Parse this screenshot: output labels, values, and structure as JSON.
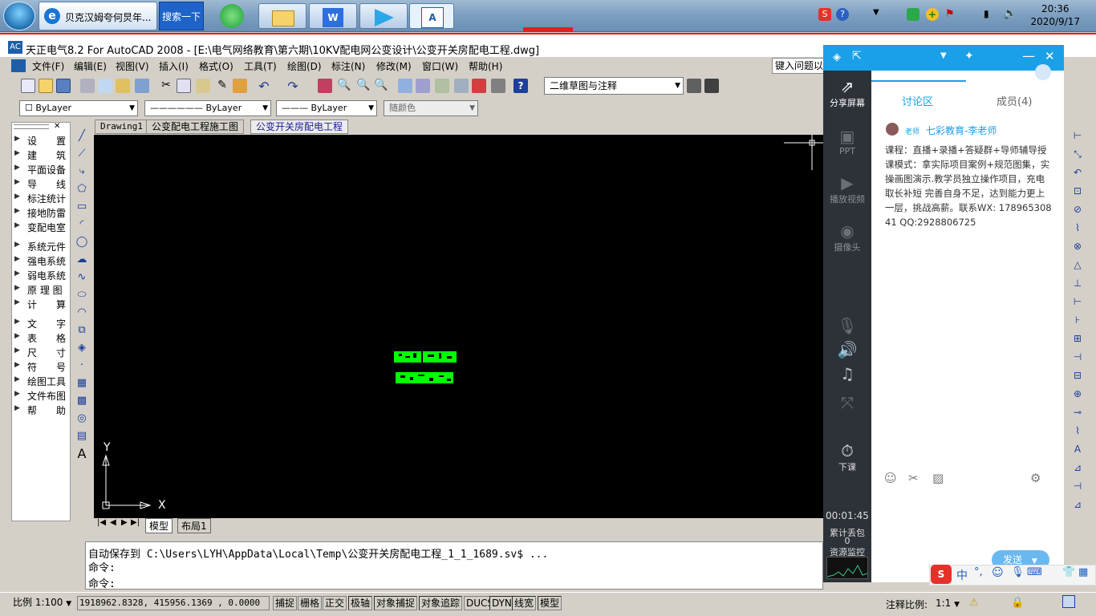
{
  "taskbar": {
    "ie_task_label": "贝克汉姆夸何炅年...",
    "search_button": "搜索一下",
    "clock_time": "20:36",
    "clock_date": "2020/9/17"
  },
  "window": {
    "title": "天正电气8.2 For AutoCAD 2008 - [E:\\电气网络教育\\第六期\\10KV配电网公变设计\\公变开关房配电工程.dwg]",
    "logo": "AC"
  },
  "menu": [
    "文件(F)",
    "编辑(E)",
    "视图(V)",
    "插入(I)",
    "格式(O)",
    "工具(T)",
    "绘图(D)",
    "标注(N)",
    "修改(M)",
    "窗口(W)",
    "帮助(H)"
  ],
  "help_search": "键入问题以",
  "toolbar": {
    "workspace": "二维草图与注释"
  },
  "layers": {
    "layer": "ByLayer",
    "linetype": "ByLayer",
    "lineweight": "ByLayer",
    "color": "随颜色"
  },
  "tianzheng_menu": [
    "设　　置",
    "建　　筑",
    "平面设备",
    "导　　线",
    "标注统计",
    "接地防雷",
    "变配电室",
    "系统元件",
    "强电系统",
    "弱电系统",
    "原 理 图",
    "计　　算",
    "文　　字",
    "表　　格",
    "尺　　寸",
    "符　　号",
    "绘图工具",
    "文件布图",
    "帮　　助"
  ],
  "doc_tabs": [
    "Drawing1",
    "公变配电工程施工图",
    "公变开关房配电工程"
  ],
  "axis": {
    "y": "Y",
    "x": "X"
  },
  "layout_tabs": [
    "模型",
    "布局1"
  ],
  "command": {
    "line1": "自动保存到 C:\\Users\\LYH\\AppData\\Local\\Temp\\公变开关房配电工程_1_1_1689.sv$ ...",
    "line2": "命令:",
    "line3": "命令:"
  },
  "status": {
    "scale": "比例 1:100",
    "coords": "1918962.8328, 415956.1369 , 0.0000",
    "toggles": [
      "捕捉",
      "栅格",
      "正交",
      "极轴",
      "对象捕捉",
      "对象追踪",
      "DUCS",
      "DYN",
      "线宽",
      "模型"
    ],
    "anno_label": "注释比例:",
    "anno_value": "1:1"
  },
  "chat": {
    "side": [
      "分享屏幕",
      "PPT",
      "播放视频",
      "摄像头",
      "下课"
    ],
    "tabs": [
      "讨论区",
      "成员(4)"
    ],
    "teacher_tag": "老师",
    "teacher_name": "七彩教育-李老师",
    "message": "课程：直播+录播+答疑群+导师辅导授课模式：拿实际项目案例+规范图集，实操画图演示.教学员独立操作项目，充电 取长补短 完善自身不足，达到能力更上一层，挑战高薪。联系WX: 17896530841 QQ:2928806725",
    "timer": "00:01:45",
    "loss_label": "累计丢包",
    "loss_value": "0",
    "monitor": "资源监控",
    "send": "发送"
  },
  "ime": {
    "lang": "中"
  },
  "colors": {
    "accent": "#1aa0e8",
    "canvas": "#000000",
    "green": "#00ff00",
    "title_red": "#e02020"
  }
}
